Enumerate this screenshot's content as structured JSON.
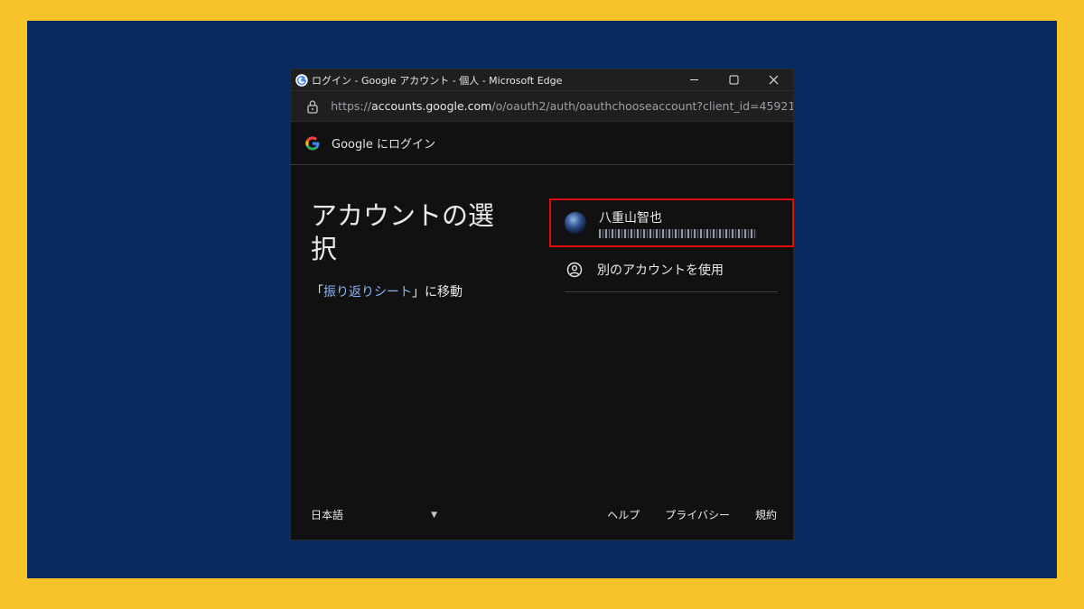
{
  "window": {
    "title": "ログイン - Google アカウント - 個人 - Microsoft Edge",
    "minimize_icon": "minimize-icon",
    "maximize_icon": "maximize-icon",
    "close_icon": "close-icon"
  },
  "address": {
    "prefix": "https://",
    "host": "accounts.google.com",
    "path": "/o/oauth2/auth/oauthchooseaccount?client_id=459218..."
  },
  "google_header": {
    "label": "Google にログイン"
  },
  "main": {
    "heading": "アカウントの選択",
    "sub_prefix": "「",
    "sub_link": "振り返りシート",
    "sub_suffix": "」に移動"
  },
  "accounts": [
    {
      "name": "八重山智也",
      "email_obscured": true
    }
  ],
  "other_account": {
    "label": "別のアカウントを使用"
  },
  "footer": {
    "language": "日本語",
    "links": [
      "ヘルプ",
      "プライバシー",
      "規約"
    ]
  },
  "colors": {
    "outer_border": "#f6c428",
    "background": "#062a61",
    "highlight": "#e10b0b",
    "link": "#8ab4f8"
  }
}
